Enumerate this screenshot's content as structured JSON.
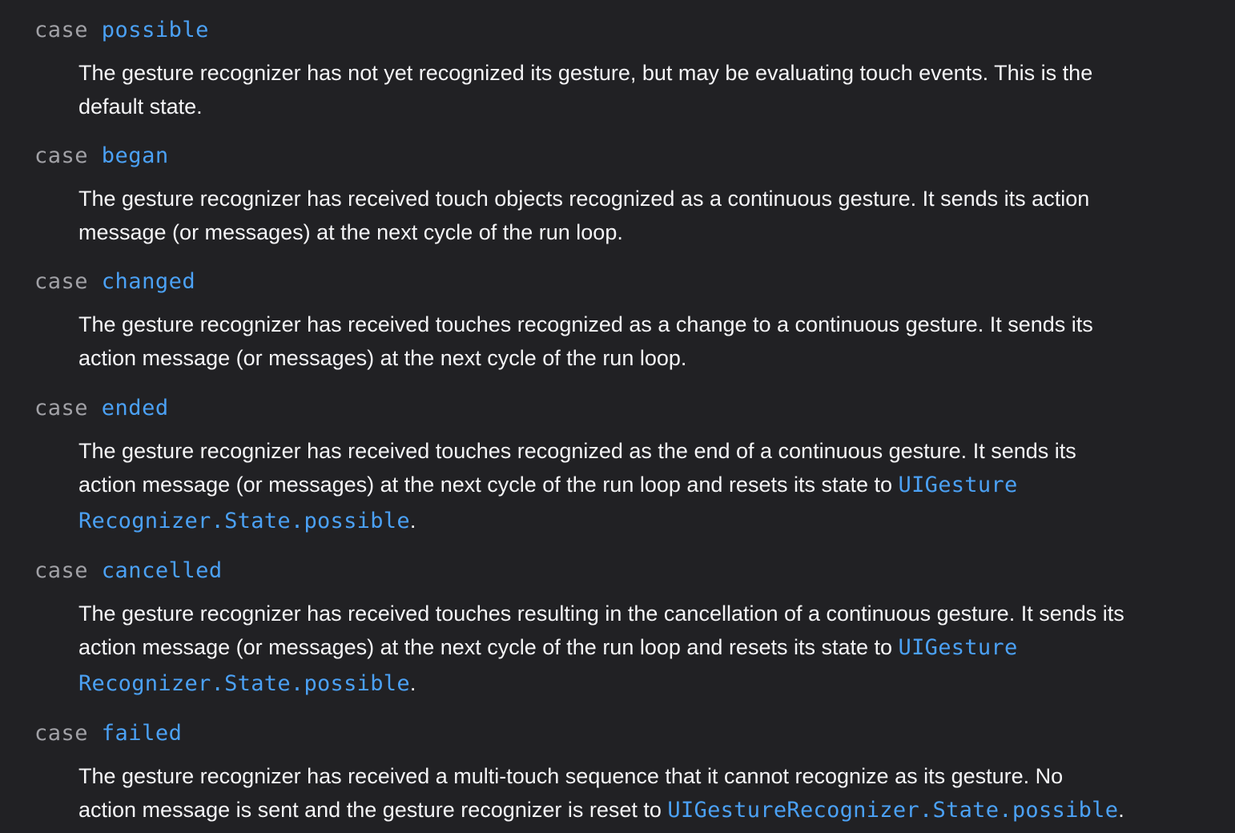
{
  "cases": [
    {
      "keyword": "case",
      "name": "possible",
      "lines": [
        "The gesture recognizer has not yet recognized its gesture, but may be evaluating touch events. This is the",
        "default state."
      ]
    },
    {
      "keyword": "case",
      "name": "began",
      "lines": [
        "The gesture recognizer has received touch objects recognized as a continuous gesture. It sends its action",
        "message (or messages) at the next cycle of the run loop."
      ]
    },
    {
      "keyword": "case",
      "name": "changed",
      "lines": [
        "The gesture recognizer has received touches recognized as a change to a continuous gesture. It sends its",
        "action message (or messages) at the next cycle of the run loop."
      ]
    },
    {
      "keyword": "case",
      "name": "ended",
      "lines": [
        "The gesture recognizer has received touches recognized as the end of a continuous gesture. It sends its",
        "action message (or messages) at the next cycle of the run loop and resets its state to "
      ],
      "link_part1": "UIGesture",
      "link_part2": "Recognizer.State.possible",
      "trailing": "."
    },
    {
      "keyword": "case",
      "name": "cancelled",
      "lines": [
        "The gesture recognizer has received touches resulting in the cancellation of a continuous gesture. It sends its",
        "action message (or messages) at the next cycle of the run loop and resets its state to "
      ],
      "link_part1": "UIGesture",
      "link_part2": "Recognizer.State.possible",
      "trailing": "."
    },
    {
      "keyword": "case",
      "name": "failed",
      "lines": [
        "The gesture recognizer has received a multi-touch sequence that it cannot recognize as its gesture. No",
        "action message is sent and the gesture recognizer is reset to "
      ],
      "link": "UIGestureRecognizer.State.possible",
      "trailing": "."
    }
  ]
}
